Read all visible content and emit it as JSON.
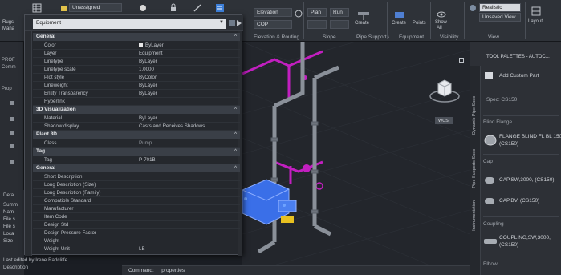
{
  "ribbon": {
    "top_left": [
      "Rugs",
      "Mana"
    ],
    "layer_combo": "Unassigned",
    "sort_combo": "Elevation",
    "cop_combo": "COP",
    "realistic_combo": "Realistic",
    "view_combo": "Unsaved View",
    "buttons": {
      "plan": "Plan",
      "run": "Run",
      "create": "Create",
      "create2": "Create",
      "show_all": [
        "Show",
        "All"
      ],
      "layout": "Layout",
      "points": "Points"
    },
    "panel_titles": [
      "Elevation & Routing",
      "Slope",
      "Pipe Supports",
      "Equipment",
      "Visibility",
      "View"
    ]
  },
  "leftstrip": {
    "labels": [
      "PROF",
      "Comm",
      "Prop"
    ],
    "details": [
      "Deta",
      "Summ",
      "Nam",
      "File s",
      "File s",
      "Loca",
      "Size"
    ],
    "last_edited": "Last edited by Irene Radcliffe",
    "description_label": "Description"
  },
  "properties": {
    "selector": "Equipment",
    "sections": [
      {
        "title": "General",
        "rows": [
          {
            "name": "Color",
            "value": "ByLayer",
            "swatch": true
          },
          {
            "name": "Layer",
            "value": "Equipment"
          },
          {
            "name": "Linetype",
            "value": "ByLayer"
          },
          {
            "name": "Linetype scale",
            "value": "1.0000"
          },
          {
            "name": "Plot style",
            "value": "ByColor"
          },
          {
            "name": "Lineweight",
            "value": "ByLayer"
          },
          {
            "name": "Entity Transparency",
            "value": "ByLayer"
          },
          {
            "name": "Hyperlink",
            "value": ""
          }
        ]
      },
      {
        "title": "3D Visualization",
        "rows": [
          {
            "name": "Material",
            "value": "ByLayer"
          },
          {
            "name": "Shadow display",
            "value": "Casts and Receives Shadows"
          }
        ]
      },
      {
        "title": "Plant 3D",
        "rows": [
          {
            "name": "Class",
            "value": "Pump",
            "dim": true
          }
        ]
      },
      {
        "title": "Tag",
        "rows": [
          {
            "name": "Tag",
            "value": "P-701B"
          }
        ]
      },
      {
        "title": "General",
        "rows": [
          {
            "name": "Short Description",
            "value": ""
          },
          {
            "name": "Long Description (Size)",
            "value": ""
          },
          {
            "name": "Long Description (Family)",
            "value": ""
          },
          {
            "name": "Compatible Standard",
            "value": ""
          },
          {
            "name": "Manufacturer",
            "value": ""
          },
          {
            "name": "Item Code",
            "value": ""
          },
          {
            "name": "Design Std",
            "value": ""
          },
          {
            "name": "Design Pressure Factor",
            "value": ""
          },
          {
            "name": "Weight",
            "value": ""
          },
          {
            "name": "Weight Unit",
            "value": "LB"
          }
        ]
      }
    ]
  },
  "viewcube": {
    "label": "WCS"
  },
  "command": {
    "prompt": "Command:",
    "text": "_properties"
  },
  "tool_palette": {
    "title": "TOOL PALETTES - AUTOC...",
    "tabs": [
      "Dynamic Pipe Spec",
      "Pipe Supports Spec",
      "Instrumentation"
    ],
    "add_custom": "Add Custom Part",
    "spec": "Spec: CS150",
    "groups": [
      {
        "head": "Blind Flange",
        "items": [
          "FLANGE BLIND FL BL 150",
          "(CS150)"
        ]
      },
      {
        "head": "Cap",
        "items": [
          "CAP,SW,3000, (CS150)"
        ]
      },
      {
        "head": "",
        "items": [
          "CAP,BV, (CS150)"
        ]
      },
      {
        "head": "Coupling",
        "items": [
          "COUPLING,SW,3000,",
          "(CS150)"
        ]
      },
      {
        "head": "Elbow",
        "items": []
      }
    ]
  },
  "colors": {
    "pipe_gray": "#8a9099",
    "pipe_magenta": "#c21fc0",
    "equipment_blue": "#3a6fe8",
    "selection_yellow": "#e8c020"
  }
}
